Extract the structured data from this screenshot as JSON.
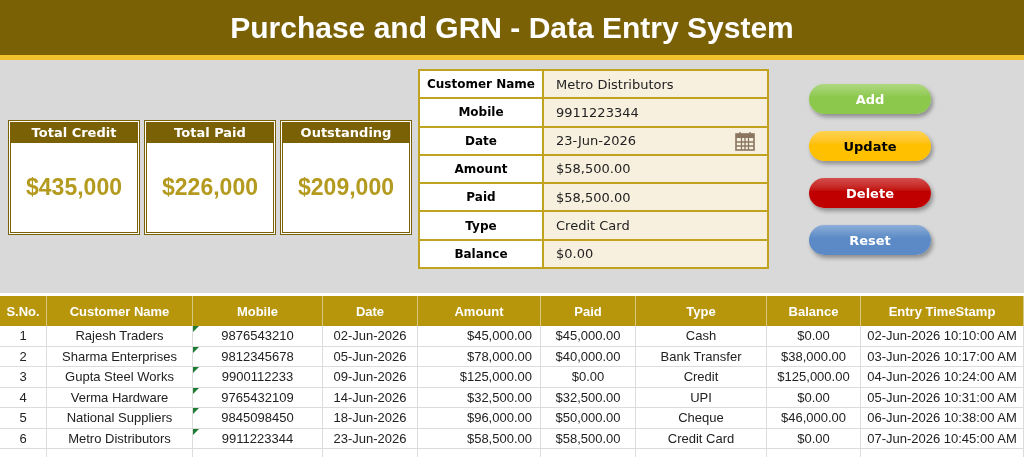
{
  "title": "Purchase and GRN - Data Entry System",
  "cards": [
    {
      "label": "Total Credit",
      "value": "$435,000"
    },
    {
      "label": "Total Paid",
      "value": "$226,000"
    },
    {
      "label": "Outstanding",
      "value": "$209,000"
    }
  ],
  "form": [
    {
      "label": "Customer Name",
      "value": "Metro Distributors",
      "kind": "text"
    },
    {
      "label": "Mobile",
      "value": "9911223344",
      "kind": "text"
    },
    {
      "label": "Date",
      "value": "23-Jun-2026",
      "kind": "date"
    },
    {
      "label": "Amount",
      "value": "$58,500.00",
      "kind": "text"
    },
    {
      "label": "Paid",
      "value": "$58,500.00",
      "kind": "text"
    },
    {
      "label": "Type",
      "value": "Credit Card",
      "kind": "text"
    },
    {
      "label": "Balance",
      "value": "$0.00",
      "kind": "text"
    }
  ],
  "buttons": [
    {
      "label": "Add",
      "color": "#8cc84b"
    },
    {
      "label": "Update",
      "color": "#ffc000"
    },
    {
      "label": "Delete",
      "color": "#c00000"
    },
    {
      "label": "Reset",
      "color": "#5b8ac6"
    }
  ],
  "table": {
    "columns": [
      "S.No.",
      "Customer Name",
      "Mobile",
      "Date",
      "Amount",
      "Paid",
      "Type",
      "Balance",
      "Entry TimeStamp"
    ],
    "rows": [
      {
        "cells": [
          "1",
          "Rajesh Traders",
          "9876543210",
          "02-Jun-2026",
          "$45,000.00",
          "$45,000.00",
          "Cash",
          "$0.00",
          "02-Jun-2026 10:10:00 AM"
        ],
        "flagged": true
      },
      {
        "cells": [
          "2",
          "Sharma Enterprises",
          "9812345678",
          "05-Jun-2026",
          "$78,000.00",
          "$40,000.00",
          "Bank Transfer",
          "$38,000.00",
          "03-Jun-2026 10:17:00 AM"
        ],
        "flagged": true
      },
      {
        "cells": [
          "3",
          "Gupta Steel Works",
          "9900112233",
          "09-Jun-2026",
          "$125,000.00",
          "$0.00",
          "Credit",
          "$125,000.00",
          "04-Jun-2026 10:24:00 AM"
        ],
        "flagged": true
      },
      {
        "cells": [
          "4",
          "Verma Hardware",
          "9765432109",
          "14-Jun-2026",
          "$32,500.00",
          "$32,500.00",
          "UPI",
          "$0.00",
          "05-Jun-2026 10:31:00 AM"
        ],
        "flagged": true
      },
      {
        "cells": [
          "5",
          "National Suppliers",
          "9845098450",
          "18-Jun-2026",
          "$96,000.00",
          "$50,000.00",
          "Cheque",
          "$46,000.00",
          "06-Jun-2026 10:38:00 AM"
        ],
        "flagged": true
      },
      {
        "cells": [
          "6",
          "Metro Distributors",
          "9911223344",
          "23-Jun-2026",
          "$58,500.00",
          "$58,500.00",
          "Credit Card",
          "$0.00",
          "07-Jun-2026 10:45:00 AM"
        ],
        "flagged": true
      }
    ]
  }
}
